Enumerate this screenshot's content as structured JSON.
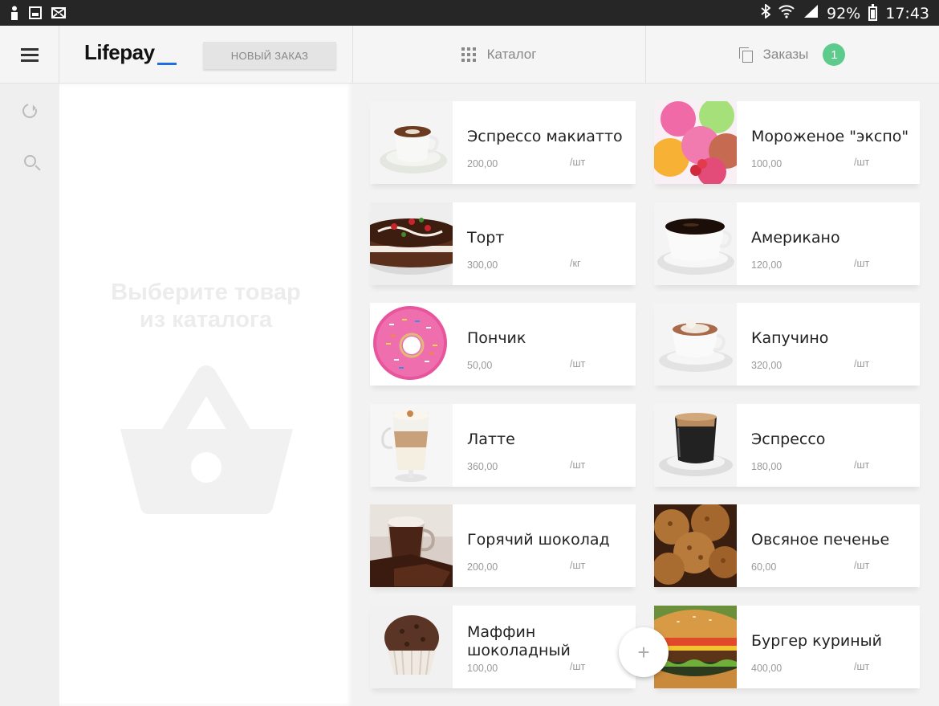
{
  "status_bar": {
    "battery": "92%",
    "time": "17:43"
  },
  "header": {
    "logo": "Lifepay",
    "new_order_label": "НОВЫЙ ЗАКАЗ",
    "tab_catalog": "Каталог",
    "tab_orders": "Заказы",
    "orders_badge": "1"
  },
  "order_panel": {
    "empty_line1": "Выберите товар",
    "empty_line2": "из каталога"
  },
  "products": [
    {
      "name": "Эспрессо макиатто",
      "price": "200,00",
      "unit": "/шт",
      "image": "espresso-macchiato"
    },
    {
      "name": "Мороженое \"экспо\"",
      "price": "100,00",
      "unit": "/шт",
      "image": "ice-cream"
    },
    {
      "name": "Торт",
      "price": "300,00",
      "unit": "/кг",
      "image": "cake"
    },
    {
      "name": "Американо",
      "price": "120,00",
      "unit": "/шт",
      "image": "americano"
    },
    {
      "name": "Пончик",
      "price": "50,00",
      "unit": "/шт",
      "image": "donut"
    },
    {
      "name": "Капучино",
      "price": "320,00",
      "unit": "/шт",
      "image": "cappuccino"
    },
    {
      "name": "Латте",
      "price": "360,00",
      "unit": "/шт",
      "image": "latte"
    },
    {
      "name": "Эспрессо",
      "price": "180,00",
      "unit": "/шт",
      "image": "espresso"
    },
    {
      "name": "Горячий шоколад",
      "price": "200,00",
      "unit": "/шт",
      "image": "hot-chocolate"
    },
    {
      "name": "Овсяное печенье",
      "price": "60,00",
      "unit": "/шт",
      "image": "oatmeal-cookies"
    },
    {
      "name": "Маффин шоколадный",
      "price": "100,00",
      "unit": "/шт",
      "image": "chocolate-muffin"
    },
    {
      "name": "Бургер куриный",
      "price": "400,00",
      "unit": "/шт",
      "image": "chicken-burger"
    }
  ],
  "fab_label": "+",
  "colors": {
    "accent": "#1f6fe0",
    "badge": "#5ccb8c",
    "background": "#f2f2f2"
  }
}
